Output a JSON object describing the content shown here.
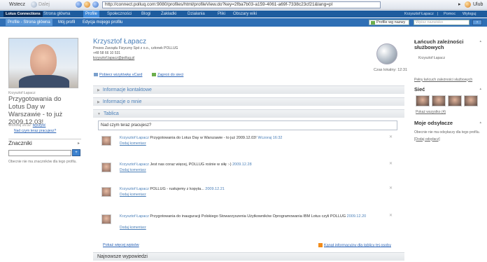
{
  "browser": {
    "back_label": "Wstecz",
    "forward_label": "Dalej",
    "url": "http://connect.polluq.com:9080/profiles/html/profileView.do?key=2fba7b03-a159-4061-a69f-7338c23cf21&lang=pl",
    "right_label": "Ulub"
  },
  "topnav": {
    "logo": "Lotus Connections",
    "items": [
      {
        "label": "Strona główna"
      },
      {
        "label": "Profile"
      },
      {
        "label": "Społeczności"
      },
      {
        "label": "Blogi"
      },
      {
        "label": "Zakładki"
      },
      {
        "label": "Działania"
      },
      {
        "label": "Pliki"
      },
      {
        "label": "Obszary wiki"
      }
    ],
    "right": {
      "user": "Krzysztof Łapacz",
      "help": "Pomoc",
      "logout": "Wyloguj"
    }
  },
  "subnav": {
    "items": [
      {
        "label": "Profile - Strona główna"
      },
      {
        "label": "Mój profil"
      },
      {
        "label": "Edycja mojego profilu"
      }
    ],
    "select_label": "Profile wg nazwy",
    "search_placeholder": "Wpisz nazwisko",
    "search_btn": "›"
  },
  "profile": {
    "name": "Krzysztof Łapacz",
    "title": "Prezes Zarządu Fizyczny Spó z o.o., członek POLLUG",
    "phone": "+48 58 66 10 531",
    "email": "krzysztof.lapacz@pollug.pl",
    "local_time": "Czas lokalny: 12:31",
    "link_vcard": "Pobierz wizytówkę vCard",
    "link_network": "Zaproś do sieci"
  },
  "left": {
    "status_label": "Krzysztof Łapacz:",
    "status": "Przygotowania do Lotus Day w Warszawie - to już 2009.12.03!",
    "status_meta_time": "Wczoraj 16:32",
    "status_meta_clear": "wyczyść",
    "status_link": "Nad czym teraz pracujesz?",
    "tags_title": "Znaczniki",
    "tags_btn": "+",
    "tags_note": "Obecnie nie ma znaczników dla tego profilu."
  },
  "sections": {
    "contact": "Informacje kontaktowe",
    "about": "Informacje o mnie",
    "board": "Tablica",
    "status_prompt": "Nad czym teraz pracujesz?",
    "latest": "Najnowsze wypowiedzi"
  },
  "feed": [
    {
      "author": "Krzysztof Łapacz",
      "text": "Przygotowania do Lotus Day w Warszawie - to już 2009.12.03!",
      "date": "Wczoraj 16:32",
      "comment": "Dodaj komentarz"
    },
    {
      "author": "Krzysztof Łapacz",
      "text": "Jest nas coraz więcej, POLLUG rośnie w siłę :-)",
      "date": "2009.12.28",
      "comment": "Dodaj komentarz"
    },
    {
      "author": "Krzysztof Łapacz",
      "text": "POLLUG - rusłujemy z kopyta...",
      "date": "2009.12.21",
      "comment": "Dodaj komentarz"
    },
    {
      "author": "Krzysztof Łapacz",
      "text": "Przygotowania do inauguracji Polskiego Stowarzyszenia Użytkowników Oprogramowania IBM Lotus czyli POLLUG",
      "date": "2009.12.20",
      "comment": "Dodaj komentarz"
    }
  ],
  "footer": {
    "more": "Pokaż więcej wpisów",
    "rss": "Kanał informacyjny dla tablicy tej osoby"
  },
  "right": {
    "chain_title": "Łańcuch zależności służbowych",
    "chain_person": "Krzysztof Łapacz",
    "chain_link": "Pełny łańcuch zależności służbowych",
    "network_title": "Sieć",
    "network_link": "Pokaż wszystko (4)",
    "refs_title": "Moje odsyłacze",
    "refs_note": "Obecnie nie ma odsyłaczy dla tego profilu.",
    "refs_link": "[Dodaj odsyłacz]"
  },
  "colors": {
    "nav": "#1e5c9e",
    "subnav": "#2f6fb5",
    "accent": "#4a7fb8"
  }
}
